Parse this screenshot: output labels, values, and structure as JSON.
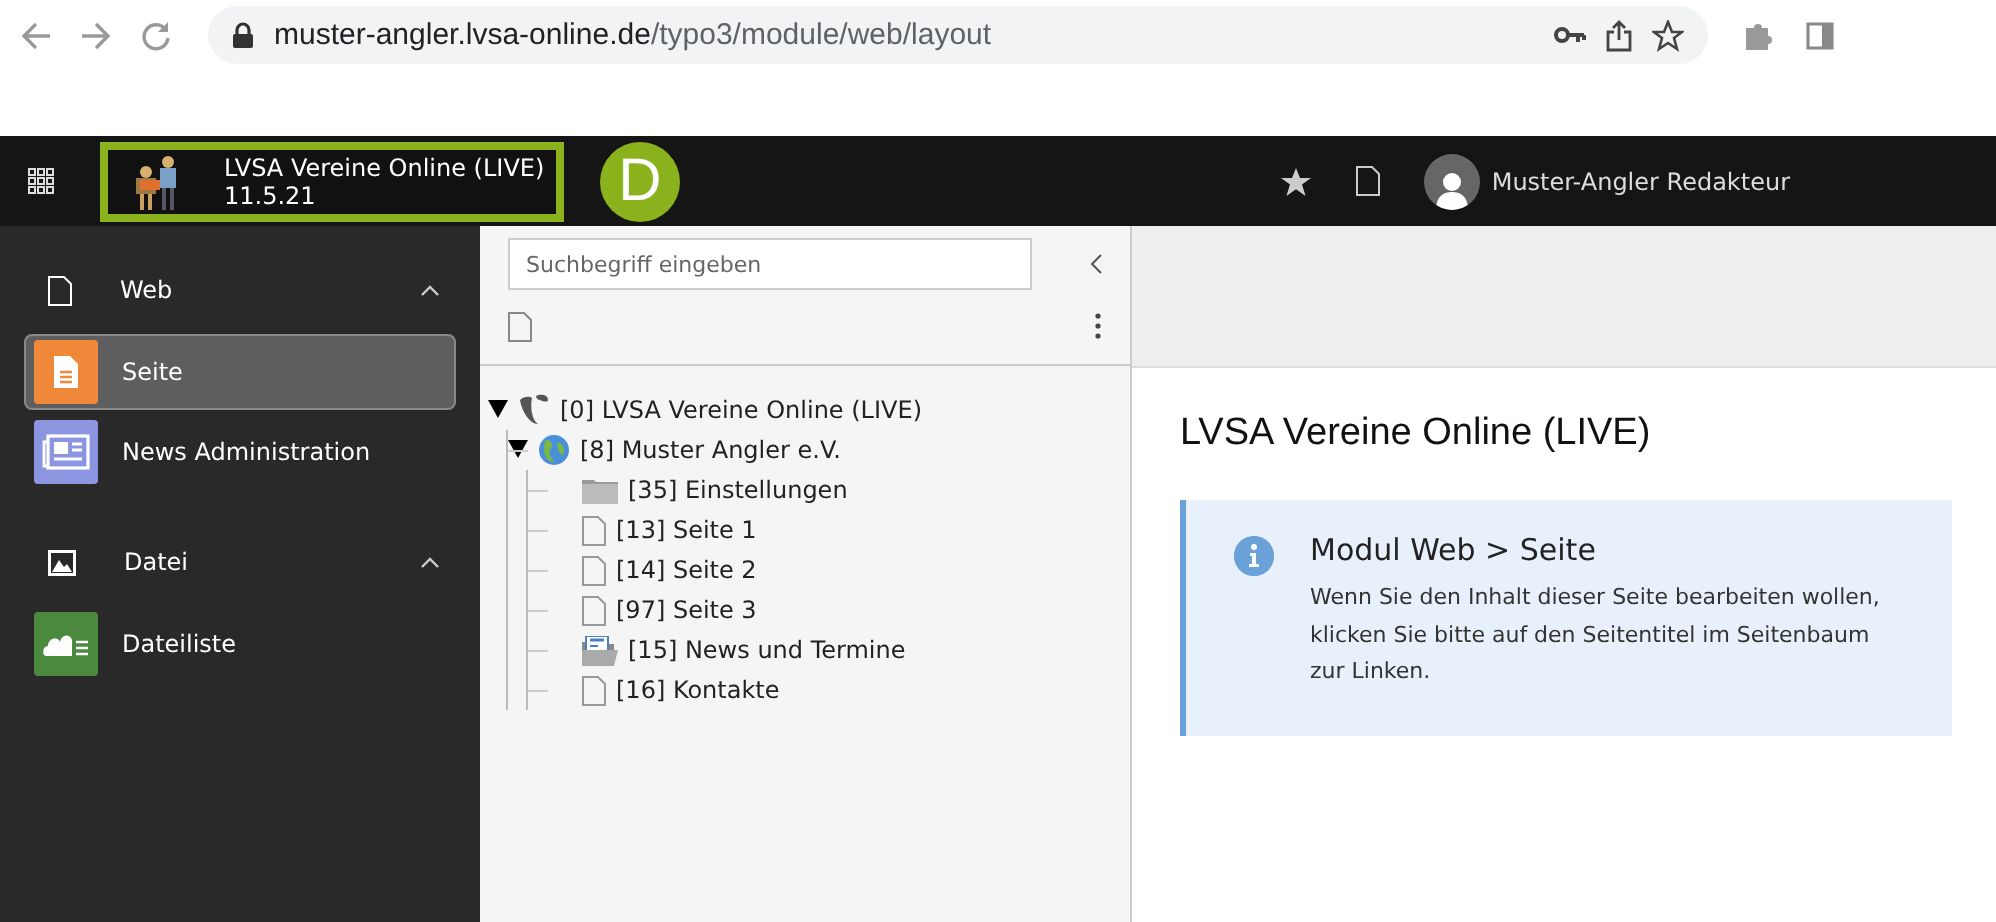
{
  "browser": {
    "url_host": "muster-angler.lvsa-online.de",
    "url_path": "/typo3/module/web/layout"
  },
  "topbar": {
    "site_name": "LVSA Vereine Online (LIVE)",
    "version": "11.5.21",
    "badge": "D",
    "user": "Muster-Angler Redakteur"
  },
  "sidebar": {
    "groups": [
      {
        "label": "Web",
        "kind": "page",
        "expanded": true,
        "items": [
          {
            "label": "Seite",
            "kind": "page",
            "color": "#f0883a",
            "selected": true
          },
          {
            "label": "News Administration",
            "kind": "news",
            "color": "#8b95e0",
            "selected": false
          }
        ]
      },
      {
        "label": "Datei",
        "kind": "image",
        "expanded": true,
        "items": [
          {
            "label": "Dateiliste",
            "kind": "cloud",
            "color": "#4b8a3e",
            "selected": false
          }
        ]
      }
    ]
  },
  "tree_panel": {
    "search": {
      "placeholder": "Suchbegriff eingeben"
    },
    "tree": [
      {
        "label": "[0] LVSA Vereine Online (LIVE)",
        "kind": "root",
        "expanded": true,
        "children": [
          {
            "label": "[8] Muster Angler e.V.",
            "kind": "site",
            "expanded": true,
            "children": [
              {
                "label": "[35] Einstellungen",
                "kind": "folder"
              },
              {
                "label": "[13] Seite 1",
                "kind": "page"
              },
              {
                "label": "[14] Seite 2",
                "kind": "page"
              },
              {
                "label": "[97] Seite 3",
                "kind": "page"
              },
              {
                "label": "[15] News und Termine",
                "kind": "news"
              },
              {
                "label": "[16] Kontakte",
                "kind": "page"
              }
            ]
          }
        ]
      }
    ]
  },
  "content": {
    "title": "LVSA Vereine Online (LIVE)",
    "callout": {
      "title": "Modul Web > Seite",
      "text": "Wenn Sie den Inhalt dieser Seite bearbeiten wollen, klicken Sie bitte auf den Seitentitel im Seitenbaum zur Linken."
    }
  }
}
